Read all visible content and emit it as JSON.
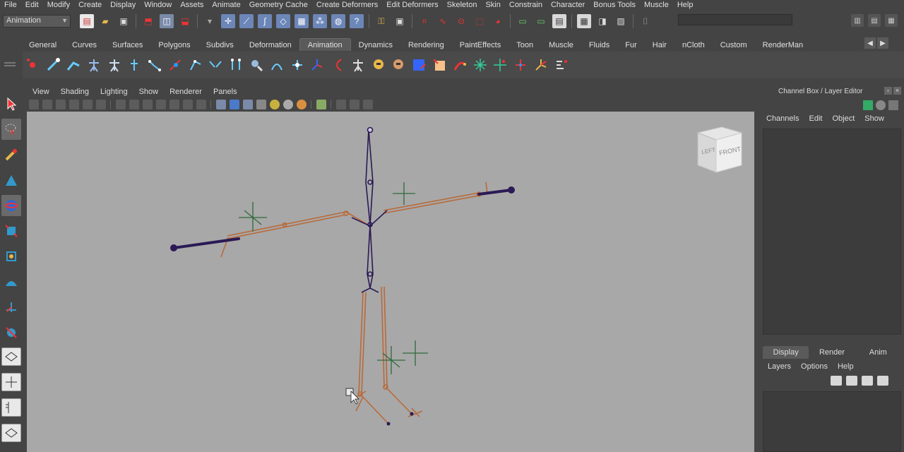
{
  "menubar": [
    "File",
    "Edit",
    "Modify",
    "Create",
    "Display",
    "Window",
    "Assets",
    "Animate",
    "Geometry Cache",
    "Create Deformers",
    "Edit Deformers",
    "Skeleton",
    "Skin",
    "Constrain",
    "Character",
    "Bonus Tools",
    "Muscle",
    "Help"
  ],
  "status": {
    "mode": "Animation"
  },
  "shelf_tabs": [
    "General",
    "Curves",
    "Surfaces",
    "Polygons",
    "Subdivs",
    "Deformation",
    "Animation",
    "Dynamics",
    "Rendering",
    "PaintEffects",
    "Toon",
    "Muscle",
    "Fluids",
    "Fur",
    "Hair",
    "nCloth",
    "Custom",
    "RenderMan"
  ],
  "shelf_active_tab": "Animation",
  "panel_menu": [
    "View",
    "Shading",
    "Lighting",
    "Show",
    "Renderer",
    "Panels"
  ],
  "viewcube": {
    "left": "LEFT",
    "front": "FRONT"
  },
  "channel_box": {
    "title": "Channel Box / Layer Editor",
    "menu": [
      "Channels",
      "Edit",
      "Object",
      "Show"
    ]
  },
  "layer_editor": {
    "tabs": [
      "Display",
      "Render",
      "Anim"
    ],
    "active_tab": "Display",
    "menu": [
      "Layers",
      "Options",
      "Help"
    ]
  },
  "colors": {
    "ui_bg": "#444444",
    "viewport_bg": "#a8a8a8",
    "joint_selected": "#2a1a55",
    "joint_bone": "#b86a3a",
    "locator": "#2e6b3a"
  }
}
